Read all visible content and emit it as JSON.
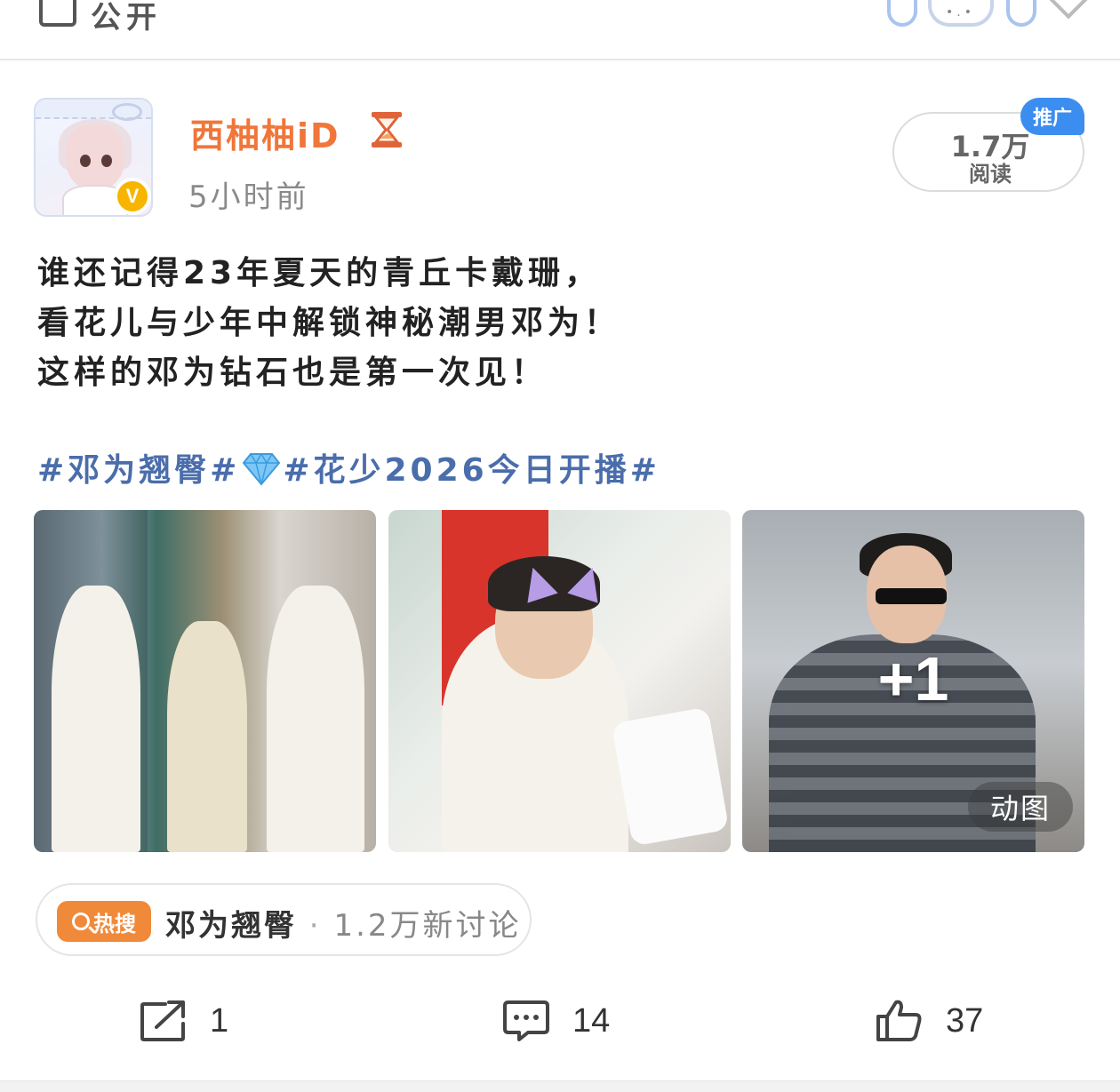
{
  "topbar": {
    "visibility_label": "公开",
    "visibility_icon": "panel-icon",
    "bunny_dots": "•.•"
  },
  "post": {
    "author": {
      "name": "西柚柚iD",
      "badge_icon": "hourglass-icon",
      "verified_mark": "V",
      "verified_color": "#f7b500",
      "name_color": "#f0763a"
    },
    "time": "5小时前",
    "reads": {
      "count": "1.7万",
      "label": "阅读",
      "promo_badge": "推广"
    },
    "text_lines": [
      "谁还记得23年夏天的青丘卡戴珊，",
      "看花儿与少年中解锁神秘潮男邓为！",
      "这样的邓为钻石也是第一次见！"
    ],
    "tags": {
      "tag1": "#邓为翘臀#",
      "tag2": "#花少2026今日开播#",
      "emoji": "diamond-icon",
      "color": "#4a6dab"
    },
    "images": {
      "more_count": "+1",
      "gif_label": "动图"
    },
    "hot_search": {
      "badge": "热搜",
      "topic": "邓为翘臀",
      "separator": " · ",
      "count": "1.2万新讨论",
      "badge_color": "#f08a3a"
    },
    "actions": {
      "share_count": "1",
      "comment_count": "14",
      "like_count": "37"
    }
  }
}
